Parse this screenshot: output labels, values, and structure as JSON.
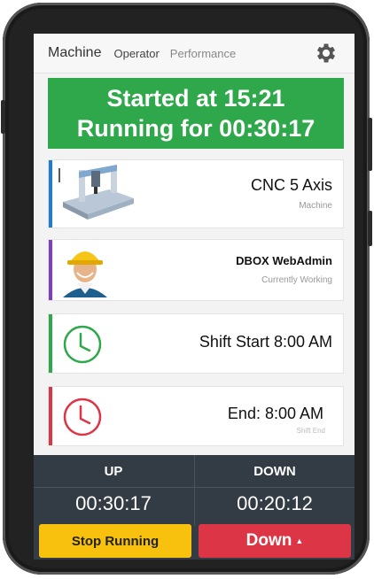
{
  "nav": {
    "brand": "Machine",
    "links": [
      "Operator",
      "Performance"
    ],
    "settings_icon": "gear-icon"
  },
  "status": {
    "line1": "Started at 15:21",
    "line2": "Running for 00:30:17",
    "color": "#2ea84a"
  },
  "cards": {
    "machine": {
      "title": "CNC 5 Axis",
      "subtitle": "Machine",
      "accent": "#1e7bd9",
      "image": "cnc-machine-image"
    },
    "operator": {
      "title": "DBOX WebAdmin",
      "subtitle": "Currently Working",
      "accent": "#7b3fbf",
      "image": "worker-avatar"
    },
    "shift_start": {
      "title": "Shift Start 8:00 AM",
      "accent": "#2ea84a",
      "icon": "clock-icon"
    },
    "shift_end": {
      "title": "End: 8:00 AM",
      "subtitle": "Shift End",
      "accent": "#dc3545",
      "icon": "clock-icon"
    }
  },
  "counters": {
    "up": {
      "label": "UP",
      "time": "00:30:17"
    },
    "down": {
      "label": "DOWN",
      "time": "00:20:12"
    }
  },
  "actions": {
    "stop_label": "Stop Running",
    "down_label": "Down",
    "stop_color": "#f7c10d",
    "down_color": "#dc3545"
  }
}
